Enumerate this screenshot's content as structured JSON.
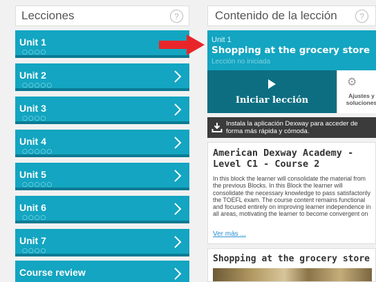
{
  "lessons_panel": {
    "title": "Lecciones",
    "help": "?",
    "units": [
      {
        "label": "Unit 1",
        "progress": "○○○○"
      },
      {
        "label": "Unit 2",
        "progress": "○○○○○"
      },
      {
        "label": "Unit 3",
        "progress": "○○○○"
      },
      {
        "label": "Unit 4",
        "progress": "○○○○○"
      },
      {
        "label": "Unit 5",
        "progress": "○○○○○"
      },
      {
        "label": "Unit 6",
        "progress": "○○○○"
      },
      {
        "label": "Unit 7",
        "progress": "○○○○"
      },
      {
        "label": "Course review",
        "progress": ""
      }
    ]
  },
  "content_panel": {
    "title": "Contenido de la lección",
    "help": "?",
    "lesson": {
      "unit": "Unit 1",
      "name": "Shopping at the grocery store",
      "status": "Lección no iniciada"
    },
    "start_button": "Iniciar lección",
    "settings_button": "Ajustes y soluciones",
    "app_banner": "Instala la aplicación Dexway para acceder de forma más rápida y cómoda.",
    "course": {
      "title": "American Dexway Academy - Level C1 - Course 2",
      "description": "In this block the learner will consolidate the material from the previous Blocks. In this Block the learner will consolidate the necessary knowledge to pass satisfactorily the TOEFL exam. The course content remains functional and focused entirely on improving learner independence in all areas, motivating the learner to become convergent on",
      "more_link": "Ver más ..."
    },
    "lesson_card_title": "Shopping at the grocery store"
  },
  "colors": {
    "accent": "#13a5c1",
    "accent_dark": "#0d6e82",
    "arrow": "#e8262a"
  }
}
